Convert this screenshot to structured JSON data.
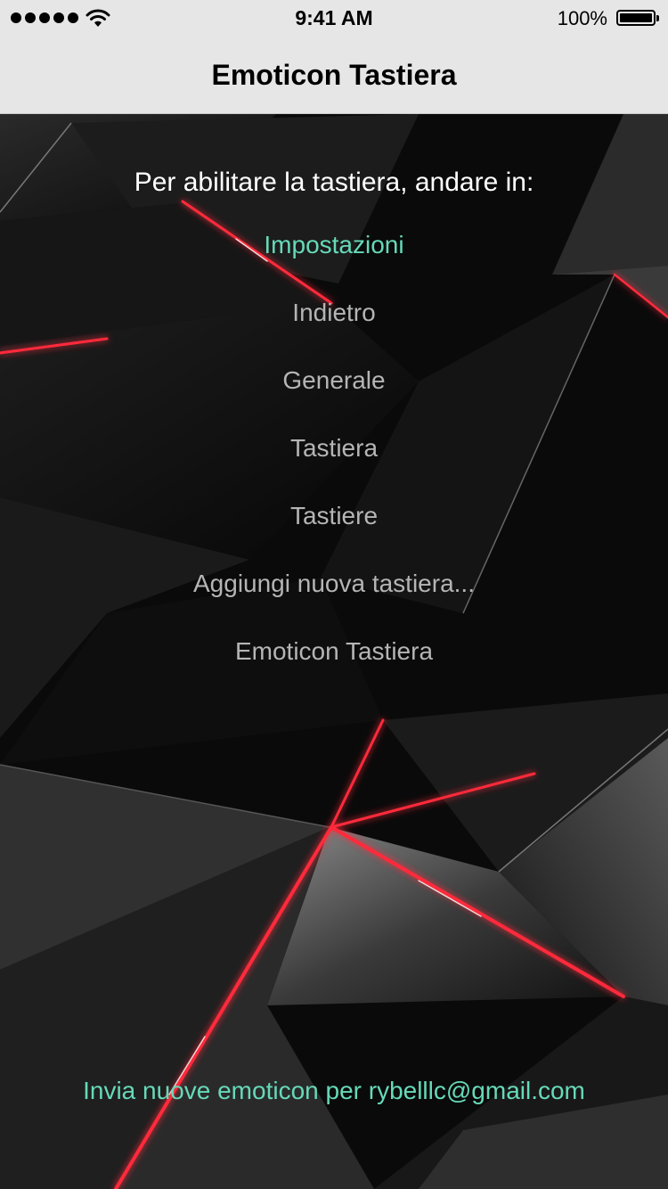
{
  "status_bar": {
    "time": "9:41 AM",
    "battery_percent": "100%",
    "signal_bars": 5,
    "icons": [
      "signal-dots-icon",
      "wifi-icon",
      "battery-icon"
    ]
  },
  "nav": {
    "title": "Emoticon Tastiera"
  },
  "instructions": {
    "title": "Per abilitare la tastiera, andare in:",
    "steps": [
      {
        "label": "Impostazioni",
        "is_link": true
      },
      {
        "label": "Indietro",
        "is_link": false
      },
      {
        "label": "Generale",
        "is_link": false
      },
      {
        "label": "Tastiera",
        "is_link": false
      },
      {
        "label": "Tastiere",
        "is_link": false
      },
      {
        "label": "Aggiungi nuova tastiera...",
        "is_link": false
      },
      {
        "label": "Emoticon Tastiera",
        "is_link": false
      }
    ]
  },
  "footer": {
    "text": "Invia nuove emoticon per rybelllc@gmail.com"
  },
  "colors": {
    "accent": "#66d9b8",
    "step_text": "#b5b5b5",
    "bar_background": "#e6e6e6",
    "highlight_red": "#ff2a3a"
  }
}
